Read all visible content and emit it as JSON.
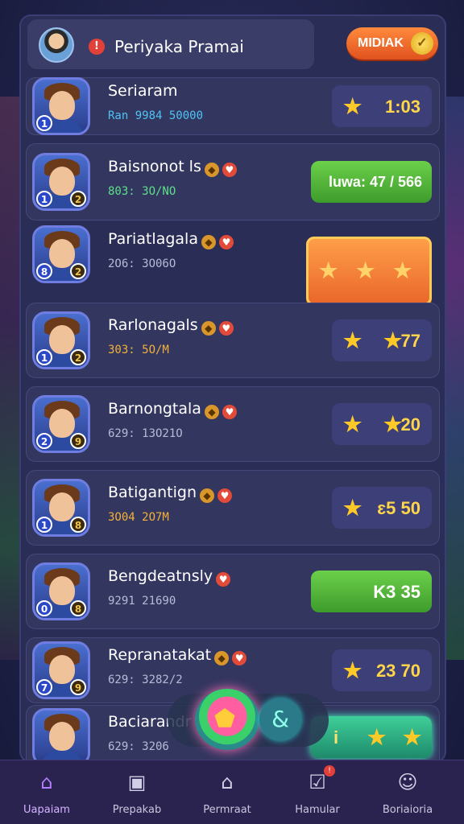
{
  "header": {
    "title": "Periyaka Pramai",
    "alert": "!",
    "button_label": "MIDIAK"
  },
  "rows": [
    {
      "name": "Seriaram",
      "sub": "Ran 9984 50000",
      "score": "1:03",
      "style": "plain",
      "stars": 1,
      "b1": "1",
      "b2": ""
    },
    {
      "name": "Baisnonot ls",
      "sub": "803: 3O/NO",
      "score": "luwa: 47 / 566",
      "style": "green",
      "stars": 0,
      "b1": "1",
      "b2": "2"
    },
    {
      "name": "Pariatlagala",
      "sub": "2O6: 3O06O",
      "score": "",
      "style": "orange",
      "stars": 3,
      "b1": "8",
      "b2": "2"
    },
    {
      "name": "Rarlonagals",
      "sub": "303: 5O/M",
      "score": "77",
      "style": "plain",
      "stars": 2,
      "b1": "1",
      "b2": "2"
    },
    {
      "name": "Barnongtala",
      "sub": "629: 13O21O",
      "score": "20",
      "style": "plain",
      "stars": 2,
      "b1": "2",
      "b2": "9"
    },
    {
      "name": "Batigantign",
      "sub": "3O04 2O7M",
      "score": "ɛ5 50",
      "style": "plain",
      "stars": 1,
      "b1": "1",
      "b2": "8"
    },
    {
      "name": "Bengdeatnsly",
      "sub": "9291 21690",
      "score": "K3 35",
      "style": "green",
      "stars": 0,
      "b1": "0",
      "b2": "8"
    },
    {
      "name": "Repranatakat",
      "sub": "629: 3282/2",
      "score": "23 70",
      "style": "plain",
      "stars": 1,
      "b1": "7",
      "b2": "9"
    },
    {
      "name": "Baciarandr",
      "sub": "629: 3206",
      "score": "i",
      "style": "teal",
      "stars": 2,
      "b1": "",
      "b2": ""
    }
  ],
  "nav": [
    {
      "label": "Uapaiam",
      "icon": "home-icon",
      "glyph": "⌂",
      "active": true
    },
    {
      "label": "Prepakab",
      "icon": "building-icon",
      "glyph": "▣",
      "active": false
    },
    {
      "label": "Permraat",
      "icon": "house-icon",
      "glyph": "⌂",
      "active": false
    },
    {
      "label": "Hamular",
      "icon": "check-box-icon",
      "glyph": "☑",
      "active": false,
      "dot": "!"
    },
    {
      "label": "Boriaioria",
      "icon": "profile-icon",
      "glyph": "☺",
      "active": false
    }
  ],
  "colors": {
    "accent": "#ff8a3c",
    "panel": "#2a2d55",
    "star": "#ffc928",
    "green": "#5ee08a"
  }
}
